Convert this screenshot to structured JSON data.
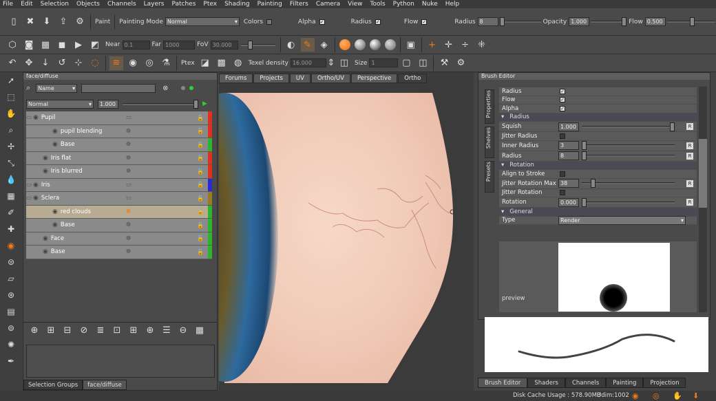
{
  "menubar": [
    "File",
    "Edit",
    "Selection",
    "Objects",
    "Channels",
    "Layers",
    "Patches",
    "Ptex",
    "Shading",
    "Painting",
    "Filters",
    "Camera",
    "View",
    "Tools",
    "Python",
    "Nuke",
    "Help"
  ],
  "toolbar1": {
    "paint_label": "Paint",
    "painting_mode_label": "Painting Mode",
    "painting_mode_value": "Normal",
    "colors_label": "Colors",
    "alpha_label": "Alpha",
    "radius_check_label": "Radius",
    "flow_check_label": "Flow",
    "radius_label": "Radius",
    "radius_value": "8",
    "opacity_label": "Opacity",
    "opacity_value": "1.000",
    "flow_label": "Flow",
    "flow_value": "0.500"
  },
  "toolbar2": {
    "near_label": "Near",
    "near_value": "0.1",
    "far_label": "Far",
    "far_value": "1000",
    "fov_label": "FoV",
    "fov_value": "30.000"
  },
  "toolbar3": {
    "ptex_label": "Ptex",
    "texel_label": "Texel density",
    "texel_value": "16.000",
    "size_label": "Size",
    "size_value": "1"
  },
  "layers_panel": {
    "title": "face/diffuse",
    "filter_mode": "Name",
    "blend_mode": "Normal",
    "opacity": "1.000",
    "rows": [
      {
        "name": "Pupil",
        "indent": 0,
        "color": "#e0301e"
      },
      {
        "name": "pupil blending",
        "indent": 2,
        "color": "#e0301e"
      },
      {
        "name": "Base",
        "indent": 2,
        "color": "#2db52d"
      },
      {
        "name": "Iris flat",
        "indent": 1,
        "color": "#e0301e"
      },
      {
        "name": "Iris blurred",
        "indent": 1,
        "color": "#e0301e"
      },
      {
        "name": "Iris",
        "indent": 0,
        "color": "#2a2ad6"
      },
      {
        "name": "Sclera",
        "indent": 0,
        "color": "#9a7a22"
      },
      {
        "name": "red clouds",
        "indent": 2,
        "color": "#2db52d",
        "selected": true
      },
      {
        "name": "Base",
        "indent": 2,
        "color": "#2db52d"
      },
      {
        "name": "Face",
        "indent": 1,
        "color": "#2db52d"
      },
      {
        "name": "Base",
        "indent": 1,
        "color": "#2db52d"
      }
    ],
    "bottom_tabs": [
      "Selection Groups",
      "face/diffuse"
    ]
  },
  "viewport": {
    "tabs": [
      "Forums",
      "Projects",
      "UV",
      "Ortho/UV",
      "Perspective",
      "Ortho"
    ]
  },
  "brush_editor": {
    "title": "Brush Editor",
    "side_tabs": [
      "Properties",
      "Shelves",
      "Presets"
    ],
    "rows": [
      {
        "label": "Radius",
        "kind": "check"
      },
      {
        "label": "Flow",
        "kind": "check"
      },
      {
        "label": "Alpha",
        "kind": "check"
      },
      {
        "label": "Radius",
        "kind": "group"
      },
      {
        "label": "Squish",
        "kind": "slider",
        "value": "1.000",
        "level": 1.0
      },
      {
        "label": "Jitter Radius",
        "kind": "empty"
      },
      {
        "label": "Inner Radius",
        "kind": "slider",
        "value": "3",
        "level": 0.0
      },
      {
        "label": "Radius",
        "kind": "slider",
        "value": "8",
        "level": 0.0
      },
      {
        "label": "Rotation",
        "kind": "group"
      },
      {
        "label": "Align to Stroke",
        "kind": "empty"
      },
      {
        "label": "Jitter Rotation Max",
        "kind": "slider",
        "value": "38",
        "level": 0.1
      },
      {
        "label": "Jitter Rotation",
        "kind": "empty"
      },
      {
        "label": "Rotation",
        "kind": "slider",
        "value": "0.000",
        "level": 0.0
      },
      {
        "label": "General",
        "kind": "group"
      },
      {
        "label": "Type",
        "kind": "dropdown",
        "value": "Render"
      }
    ],
    "preview_label": "preview",
    "reset_label": "R"
  },
  "bottom_tabs_right": [
    "Brush Editor",
    "Shaders",
    "Channels",
    "Painting",
    "Projection"
  ],
  "status": {
    "disk_cache": "Disk Cache Usage : 578.90MB",
    "udim": "Udim:1002"
  },
  "colors": {
    "accent_orange": "#ef7a1a",
    "sclera_bg": "#f2cfc0",
    "iris_blue": "#2c5e8e"
  }
}
